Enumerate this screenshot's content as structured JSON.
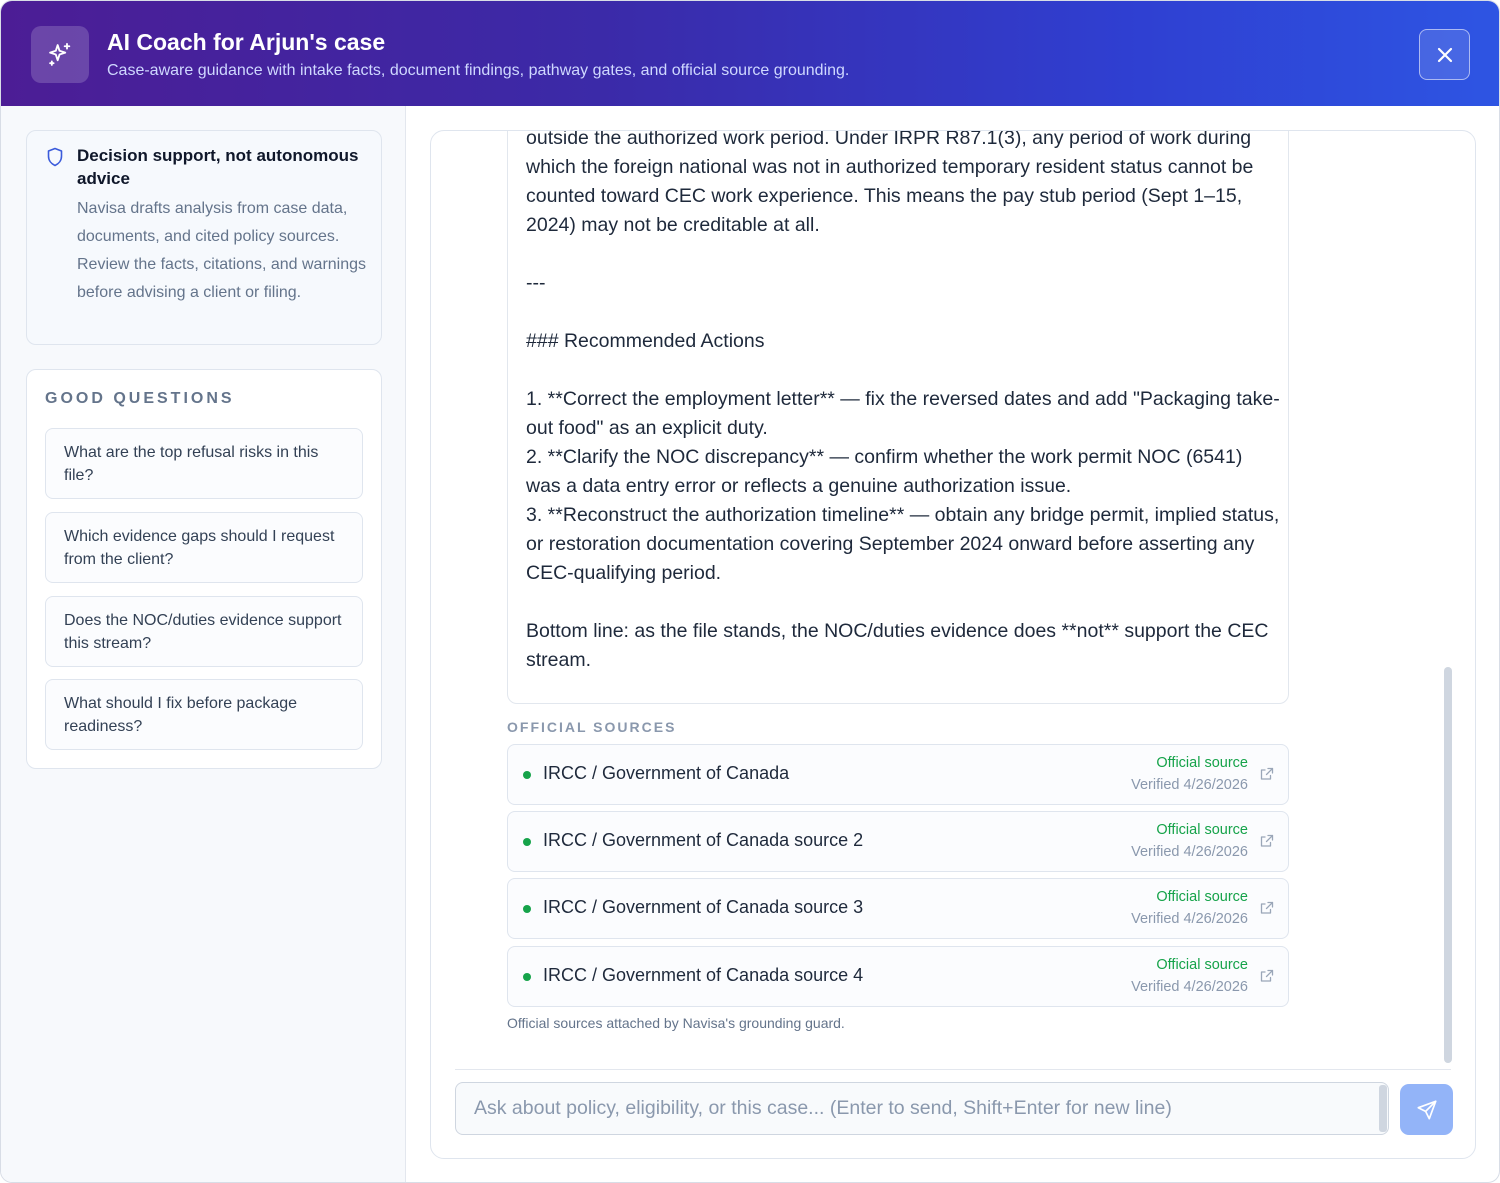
{
  "header": {
    "title": "AI Coach for Arjun's case",
    "subtitle": "Case-aware guidance with intake facts, document findings, pathway gates, and official source grounding.",
    "icon": "sparkles-icon",
    "close_icon": "close-icon"
  },
  "sidebar": {
    "notice": {
      "icon": "shield-icon",
      "title": "Decision support, not autonomous advice",
      "body": "Navisa drafts analysis from case data, documents, and cited policy sources. Review the facts, citations, and warnings before advising a client or filing."
    },
    "questions": {
      "heading": "GOOD QUESTIONS",
      "items": [
        "What are the top refusal risks in this file?",
        "Which evidence gaps should I request from the client?",
        "Does the NOC/duties evidence support this stream?",
        "What should I fix before package readiness?"
      ]
    }
  },
  "message": {
    "text": "outside the authorized work period. Under IRPR R87.1(3), any period of work during which the foreign national was not in authorized temporary resident status cannot be counted toward CEC work experience. This means the pay stub period (Sept 1–15, 2024) may not be creditable at all.\n\n---\n\n### Recommended Actions\n\n1. **Correct the employment letter** — fix the reversed dates and add \"Packaging take-out food\" as an explicit duty.\n2. **Clarify the NOC discrepancy** — confirm whether the work permit NOC (6541) was a data entry error or reflects a genuine authorization issue.\n3. **Reconstruct the authorization timeline** — obtain any bridge permit, implied status, or restoration documentation covering September 2024 onward before asserting any CEC-qualifying period.\n\nBottom line: as the file stands, the NOC/duties evidence does **not** support the CEC stream."
  },
  "sources": {
    "heading": "OFFICIAL SOURCES",
    "items": [
      {
        "name": "IRCC / Government of Canada",
        "status": "Official source",
        "verified": "Verified 4/26/2026"
      },
      {
        "name": "IRCC / Government of Canada source 2",
        "status": "Official source",
        "verified": "Verified 4/26/2026"
      },
      {
        "name": "IRCC / Government of Canada source 3",
        "status": "Official source",
        "verified": "Verified 4/26/2026"
      },
      {
        "name": "IRCC / Government of Canada source 4",
        "status": "Official source",
        "verified": "Verified 4/26/2026"
      }
    ],
    "footnote": "Official sources attached by Navisa's grounding guard.",
    "status_color": "#16a34a",
    "link_icon": "external-link-icon"
  },
  "composer": {
    "placeholder": "Ask about policy, eligibility, or this case... (Enter to send, Shift+Enter for new line)",
    "value": "",
    "send_icon": "send-icon"
  },
  "colors": {
    "header_gradient_start": "#4c1d95",
    "header_gradient_end": "#2e55e3",
    "send_button": "#93b4f8"
  }
}
